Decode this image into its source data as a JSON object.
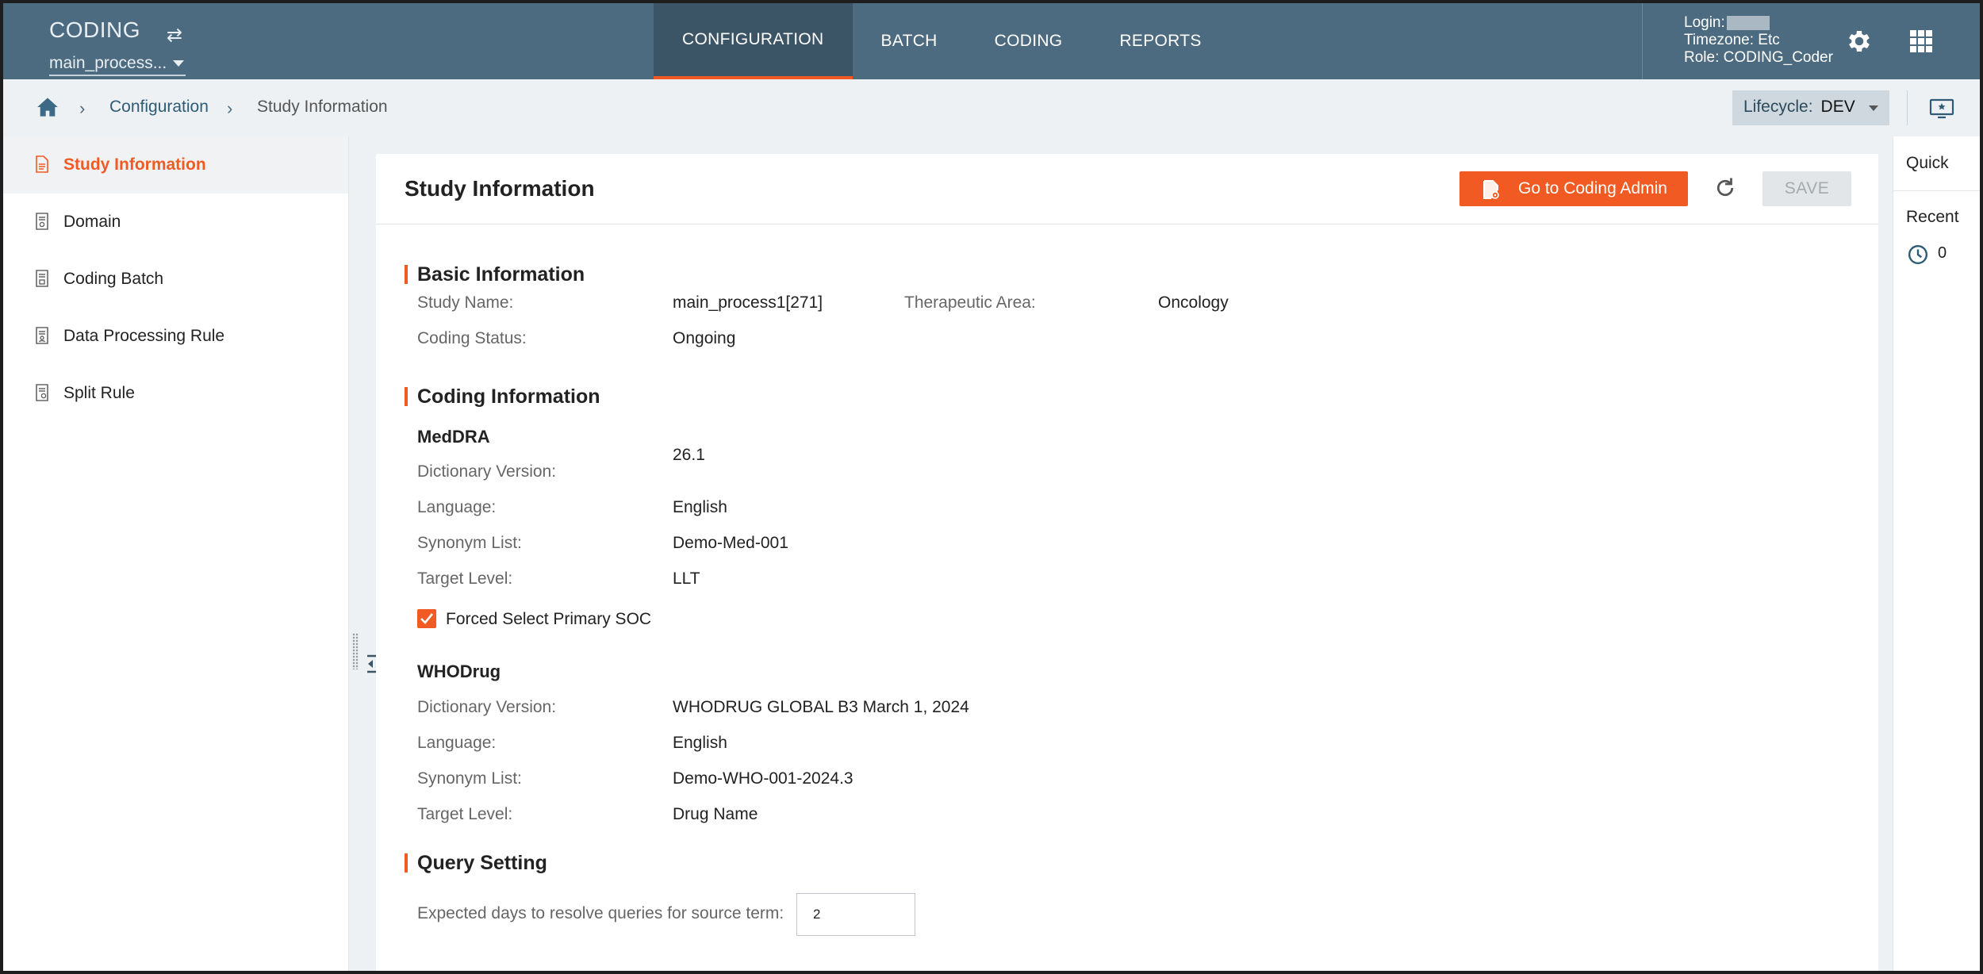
{
  "app": {
    "name": "CODING",
    "study_selector": "main_process..."
  },
  "nav": {
    "items": [
      "CONFIGURATION",
      "BATCH",
      "CODING",
      "REPORTS"
    ],
    "active": "CONFIGURATION"
  },
  "user": {
    "login_label": "Login:",
    "timezone": "Timezone: Etc",
    "role": "Role: CODING_Coder"
  },
  "breadcrumb": {
    "items": [
      "Configuration",
      "Study Information"
    ]
  },
  "lifecycle": {
    "label": "Lifecycle:",
    "value": "DEV"
  },
  "sidebar": {
    "items": [
      "Study Information",
      "Domain",
      "Coding Batch",
      "Data Processing Rule",
      "Split Rule"
    ],
    "active": "Study Information"
  },
  "panel": {
    "title": "Study Information",
    "admin_button": "Go to Coding Admin",
    "save_button": "SAVE"
  },
  "basic_info": {
    "title": "Basic Information",
    "study_name_label": "Study Name:",
    "study_name": "main_process1[271]",
    "therapeutic_area_label": "Therapeutic Area:",
    "therapeutic_area": "Oncology",
    "coding_status_label": "Coding Status:",
    "coding_status": "Ongoing"
  },
  "coding_info": {
    "title": "Coding Information",
    "meddra": {
      "title": "MedDRA",
      "dictionary_version_label": "Dictionary Version:",
      "dictionary_version": "26.1",
      "language_label": "Language:",
      "language": "English",
      "synonym_list_label": "Synonym List:",
      "synonym_list": "Demo-Med-001",
      "target_level_label": "Target Level:",
      "target_level": "LLT",
      "forced_soc_label": "Forced Select Primary SOC",
      "forced_soc_checked": true
    },
    "whodrug": {
      "title": "WHODrug",
      "dictionary_version_label": "Dictionary Version:",
      "dictionary_version": "WHODRUG GLOBAL B3 March 1, 2024",
      "language_label": "Language:",
      "language": "English",
      "synonym_list_label": "Synonym List:",
      "synonym_list": "Demo-WHO-001-2024.3",
      "target_level_label": "Target Level:",
      "target_level": "Drug Name"
    }
  },
  "query_setting": {
    "title": "Query Setting",
    "expected_days_label": "Expected days to resolve queries for source term:",
    "expected_days": "2"
  },
  "quick_panel": {
    "quick_label": "Quick",
    "recent_label": "Recent",
    "recent_count": "0"
  },
  "colors": {
    "header": "#4d6b80",
    "accent": "#f15a22",
    "breadcrumb_bg": "#eef1f3"
  }
}
